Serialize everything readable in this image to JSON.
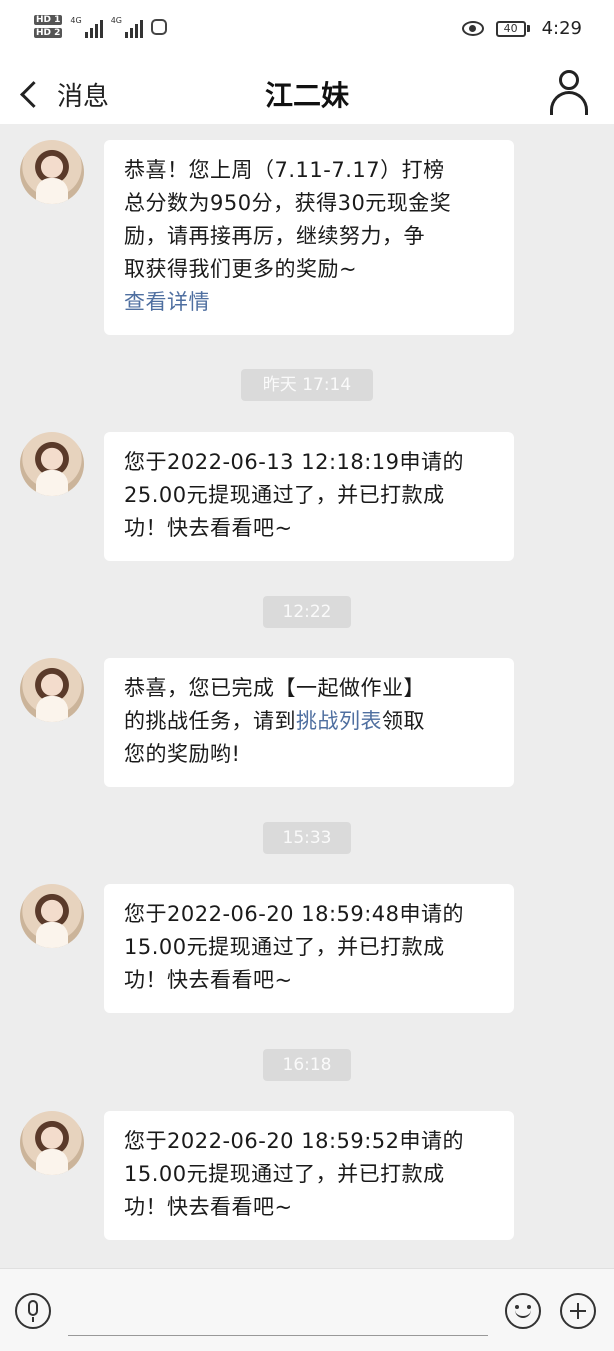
{
  "status_bar": {
    "sim1": "HD 1",
    "sim2": "HD 2",
    "net1": "4G",
    "net2": "4G",
    "battery": "40",
    "time": "4:29"
  },
  "header": {
    "back_label": "消息",
    "title": "江二妹"
  },
  "messages": [
    {
      "lines": [
        "恭喜！您上周（7.11-7.17）打榜",
        "总分数为950分，获得30元现金奖",
        "励，请再接再厉，继续努力，争",
        "取获得我们更多的奖励~"
      ],
      "link": "查看详情"
    },
    {
      "timestamp": "昨天 17:14",
      "lines": [
        "您于2022-06-13 12:18:19申请的",
        "25.00元提现通过了，并已打款成",
        "功！快去看看吧~"
      ]
    },
    {
      "timestamp": "12:22",
      "lines": [
        "恭喜，您已完成【一起做作业】"
      ],
      "line2_prefix": "的挑战任务，请到",
      "line2_link": "挑战列表",
      "line2_suffix": "领取",
      "line3": "您的奖励哟!"
    },
    {
      "timestamp": "15:33",
      "lines": [
        "您于2022-06-20 18:59:48申请的",
        "15.00元提现通过了，并已打款成",
        "功！快去看看吧~"
      ]
    },
    {
      "timestamp": "16:18",
      "lines": [
        "您于2022-06-20 18:59:52申请的",
        "15.00元提现通过了，并已打款成",
        "功！快去看看吧~"
      ]
    }
  ],
  "icons": {
    "back": "chevron-left-icon",
    "profile": "person-icon",
    "voice": "microphone-icon",
    "emoji": "smiley-icon",
    "more": "plus-icon"
  },
  "colors": {
    "link": "#4f6fa0",
    "background": "#ededed",
    "timestamp_pill": "#dadada"
  }
}
